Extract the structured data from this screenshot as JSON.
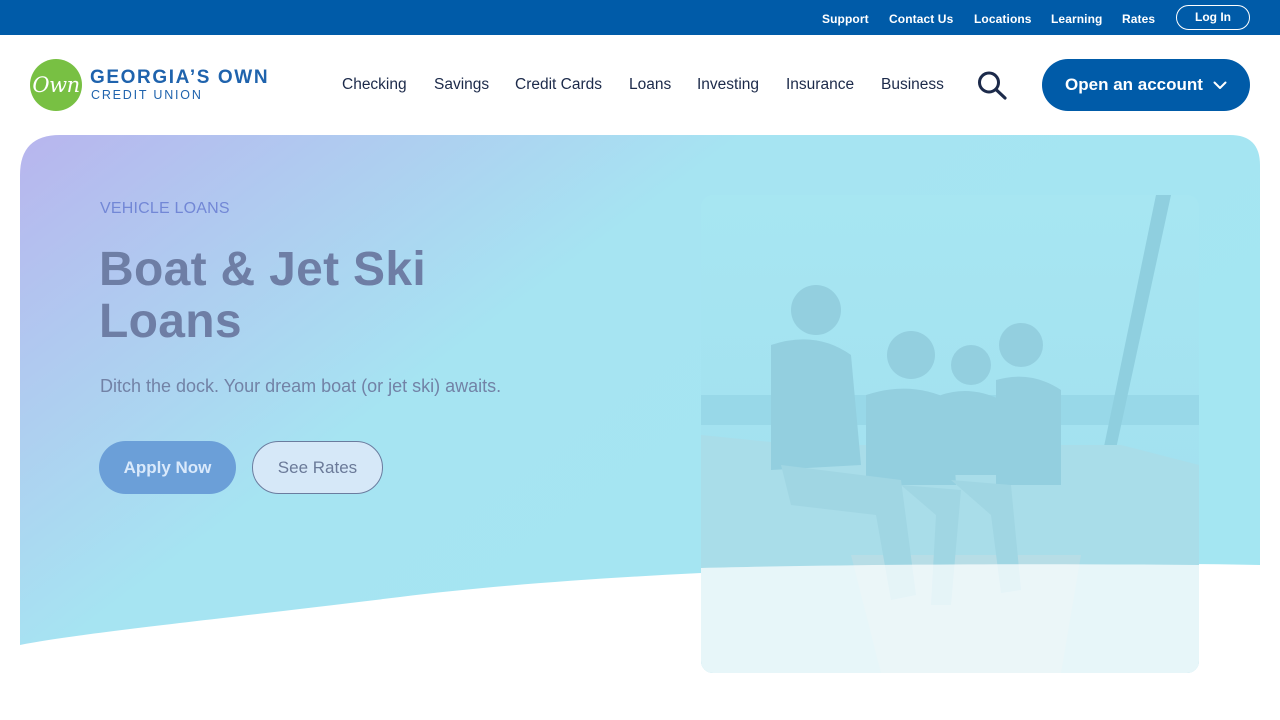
{
  "utility_nav": {
    "links": [
      "Support",
      "Contact Us",
      "Locations",
      "Learning",
      "Rates"
    ],
    "login_label": "Log In"
  },
  "brand": {
    "logo_mark": "Own",
    "name_line1": "GEORGIA’S OWN",
    "name_line2": "CREDIT UNION",
    "logo_color": "#78c043",
    "brand_color": "#005ba8"
  },
  "main_nav": {
    "items": [
      "Checking",
      "Savings",
      "Credit Cards",
      "Loans",
      "Investing",
      "Insurance",
      "Business"
    ],
    "search_icon": "search-icon",
    "cta_label": "Open an account",
    "cta_icon": "chevron-down-icon"
  },
  "hero": {
    "eyebrow": "VEHICLE LOANS",
    "title": "Boat & Jet Ski Loans",
    "subtitle": "Ditch the dock. Your dream boat (or jet ski) awaits.",
    "primary_button": "Apply Now",
    "secondary_button": "See Rates",
    "gradient_colors": [
      "#b8b5ee",
      "#a4e6f2"
    ]
  }
}
